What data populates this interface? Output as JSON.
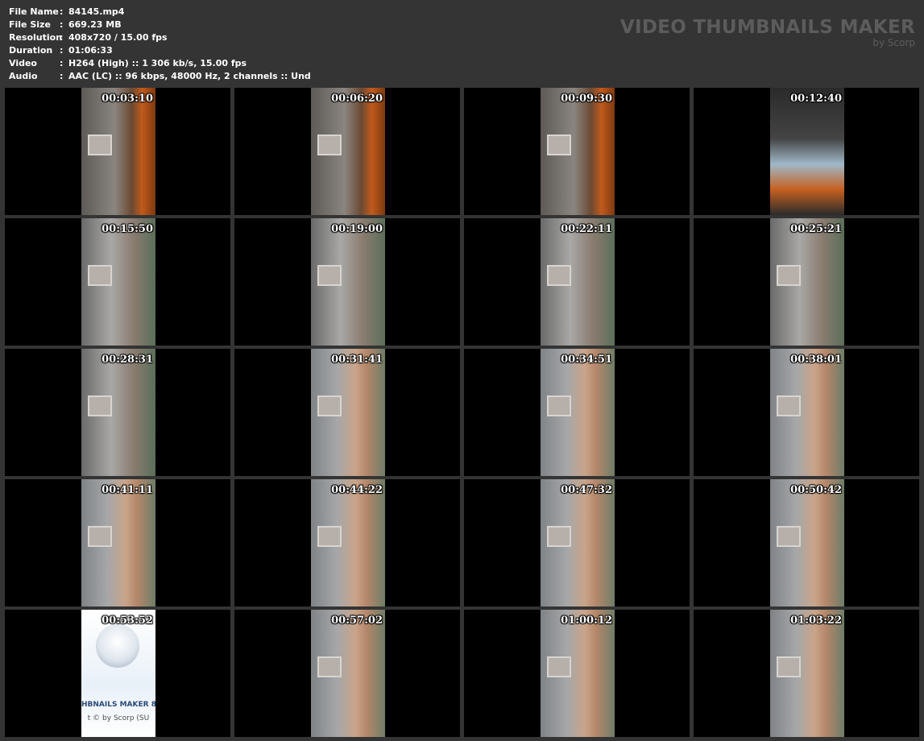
{
  "info": [
    {
      "key": "File Name",
      "value": "84145.mp4"
    },
    {
      "key": "File Size",
      "value": "669.23 MB"
    },
    {
      "key": "Resolution",
      "value": "408x720 / 15.00 fps"
    },
    {
      "key": "Duration",
      "value": "01:06:33"
    },
    {
      "key": "Video",
      "value": "H264 (High) :: 1 306 kb/s, 15.00 fps"
    },
    {
      "key": "Audio",
      "value": "AAC (LC) :: 96 kbps, 48000 Hz, 2 channels :: Und"
    }
  ],
  "separator": ":",
  "brand": {
    "title": "VIDEO THUMBNAILS MAKER",
    "subtitle": "by Scorp"
  },
  "logo_frame": {
    "line1": "HBNAILS MAKER 8",
    "line2": "t © by Scorp (SU"
  },
  "thumbnails": [
    {
      "time": "00:03:10",
      "scene": "chair"
    },
    {
      "time": "00:06:20",
      "scene": "chair"
    },
    {
      "time": "00:09:30",
      "scene": "chair"
    },
    {
      "time": "00:12:40",
      "scene": "dark"
    },
    {
      "time": "00:15:50",
      "scene": "floor"
    },
    {
      "time": "00:19:00",
      "scene": "floor"
    },
    {
      "time": "00:22:11",
      "scene": "floor"
    },
    {
      "time": "00:25:21",
      "scene": "floor"
    },
    {
      "time": "00:28:31",
      "scene": "floor"
    },
    {
      "time": "00:31:41",
      "scene": "skin"
    },
    {
      "time": "00:34:51",
      "scene": "skin"
    },
    {
      "time": "00:38:01",
      "scene": "skin"
    },
    {
      "time": "00:41:11",
      "scene": "skin"
    },
    {
      "time": "00:44:22",
      "scene": "skin"
    },
    {
      "time": "00:47:32",
      "scene": "skin"
    },
    {
      "time": "00:50:42",
      "scene": "skin"
    },
    {
      "time": "00:53:52",
      "scene": "logo"
    },
    {
      "time": "00:57:02",
      "scene": "skin"
    },
    {
      "time": "01:00:12",
      "scene": "skin"
    },
    {
      "time": "01:03:22",
      "scene": "skin"
    }
  ]
}
